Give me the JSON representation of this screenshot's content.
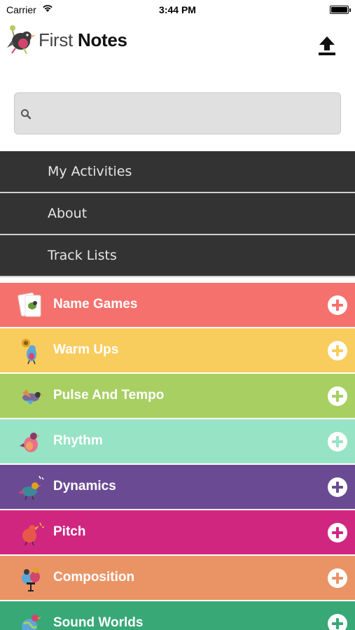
{
  "status_bar": {
    "carrier": "Carrier",
    "time": "3:44 PM"
  },
  "header": {
    "logo_first": "First",
    "logo_notes": "Notes",
    "upload_icon": "upload-icon"
  },
  "search": {
    "placeholder": "",
    "value": "",
    "icon": "search-icon"
  },
  "menu": {
    "items": [
      {
        "label": "My Activities"
      },
      {
        "label": "About"
      },
      {
        "label": "Track Lists"
      }
    ]
  },
  "categories": {
    "items": [
      {
        "label": "Name Games",
        "color": "#f5716d",
        "icon": "cards-bird-icon"
      },
      {
        "label": "Warm Ups",
        "color": "#f9cc5e",
        "icon": "sunflower-bird-icon"
      },
      {
        "label": "Pulse And Tempo",
        "color": "#a8cf62",
        "icon": "flying-bird-icon"
      },
      {
        "label": "Rhythm",
        "color": "#96e3c5",
        "icon": "pink-bird-icon"
      },
      {
        "label": "Dynamics",
        "color": "#6b4a94",
        "icon": "music-bird-icon"
      },
      {
        "label": "Pitch",
        "color": "#d12680",
        "icon": "singing-bird-icon"
      },
      {
        "label": "Composition",
        "color": "#ea9466",
        "icon": "composer-birds-icon"
      },
      {
        "label": "Sound Worlds",
        "color": "#37a876",
        "icon": "globe-bird-icon"
      }
    ]
  }
}
